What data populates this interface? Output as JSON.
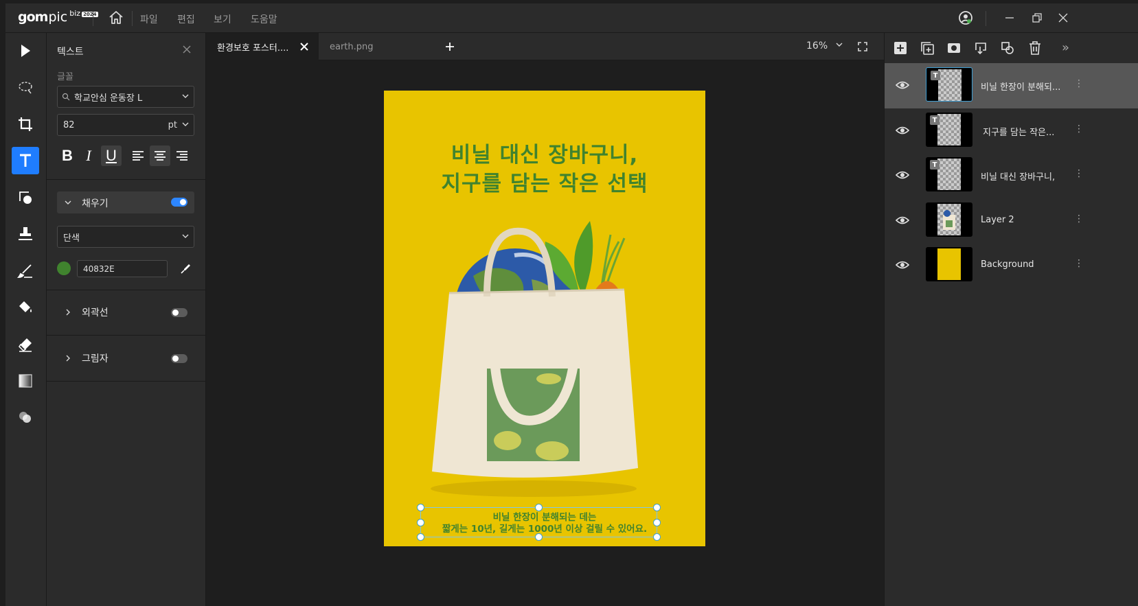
{
  "app": {
    "logo_gom": "gom",
    "logo_pic": "pic",
    "logo_biz": "biz",
    "logo_badge": "2024"
  },
  "menu": [
    "파일",
    "편집",
    "보기",
    "도움말"
  ],
  "left_tools": [
    "select-arrow-icon",
    "lasso-icon",
    "crop-icon",
    "text-icon",
    "shape-icon",
    "stamp-icon",
    "brush-icon",
    "fill-bucket-icon",
    "eraser-icon",
    "gradient-icon",
    "blend-icon"
  ],
  "props": {
    "title": "텍스트",
    "font_label": "글꼴",
    "font_value": "학교안심 운동장 L",
    "size_value": "82",
    "size_unit": "pt",
    "bold": "B",
    "italic": "I",
    "underline": "U",
    "fill_label": "채우기",
    "fill_type": "단색",
    "fill_color_hex": "40832E",
    "fill_color": "#40832e",
    "stroke_label": "외곽선",
    "shadow_label": "그림자"
  },
  "tabs": [
    {
      "label": "환경보호 포스터...."
    },
    {
      "label": "earth.png"
    }
  ],
  "zoom": "16%",
  "poster": {
    "title_line1": "비닐 대신 장바구니,",
    "title_line2": "지구를 담는 작은 선택",
    "sub_line1": "비닐 한장이 분해되는 데는",
    "sub_line2": "짧게는 10년, 길게는 1000년 이상 걸릴 수 있어요.",
    "background_color": "#e8c400",
    "text_color": "#40832e"
  },
  "layers": [
    {
      "name": "비닐 한장이 분해되...",
      "type": "text",
      "selected": true
    },
    {
      "name": "지구를 담는 작은...",
      "type": "text",
      "selected": false
    },
    {
      "name": "비닐 대신 장바구니,",
      "type": "text",
      "selected": false
    },
    {
      "name": "Layer 2",
      "type": "image",
      "selected": false
    },
    {
      "name": "Background",
      "type": "fill",
      "selected": false
    }
  ]
}
